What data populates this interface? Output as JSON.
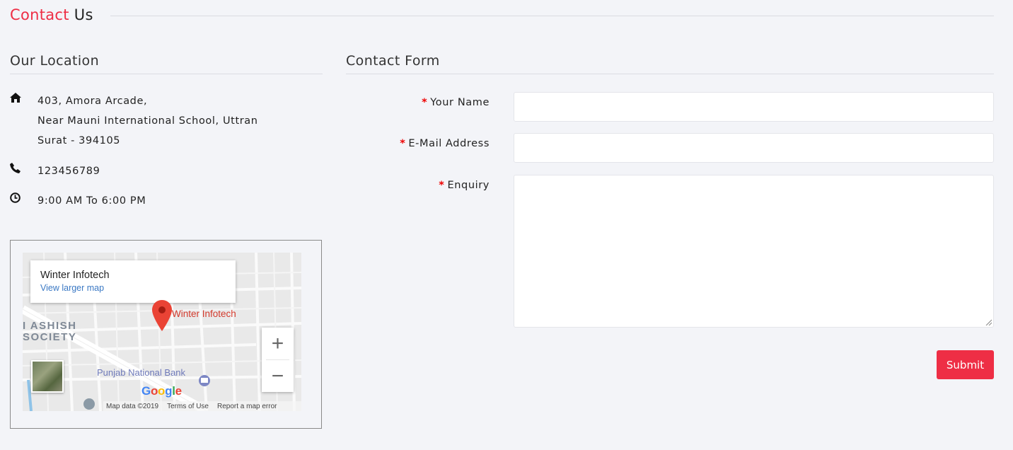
{
  "header": {
    "title_accent": "Contact",
    "title_rest": "Us"
  },
  "location": {
    "title": "Our Location",
    "address_line1": "403, Amora Arcade,",
    "address_line2": "Near Mauni International School, Uttran",
    "address_line3": "Surat - 394105",
    "phone": "123456789",
    "hours": "9:00 AM To 6:00 PM",
    "icons": [
      "home-icon",
      "phone-icon",
      "clock-icon"
    ]
  },
  "map": {
    "place_name": "Winter Infotech",
    "view_larger": "View larger map",
    "marker_label": "Winter Infotech",
    "bank_label": "Punjab National Bank",
    "society_line1": "I ASHISH",
    "society_line2": "SOCIETY",
    "zoom_in": "+",
    "zoom_out": "−",
    "google_letters": [
      "G",
      "o",
      "o",
      "g",
      "l",
      "e"
    ],
    "attribution": {
      "data": "Map data ©2019",
      "terms": "Terms of Use",
      "report": "Report a map error"
    }
  },
  "form": {
    "title": "Contact Form",
    "required_mark": "*",
    "name_label": "Your Name",
    "email_label": "E-Mail Address",
    "enquiry_label": "Enquiry",
    "name_value": "",
    "email_value": "",
    "enquiry_value": "",
    "submit_label": "Submit"
  },
  "colors": {
    "accent": "#ee2e45",
    "background": "#f3f4f8",
    "link": "#3a78c4",
    "required": "#ee0000"
  }
}
